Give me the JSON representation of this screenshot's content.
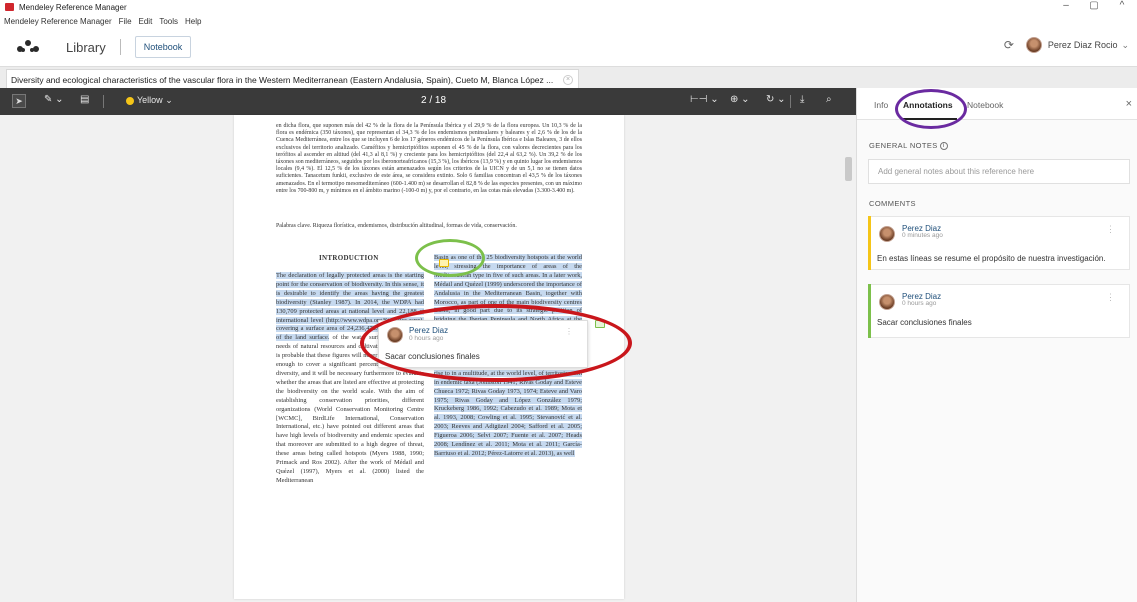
{
  "window": {
    "title": "Mendeley Reference Manager",
    "controls": [
      "–",
      "▢",
      "^"
    ]
  },
  "menu": [
    "Mendeley Reference Manager",
    "File",
    "Edit",
    "Tools",
    "Help"
  ],
  "header": {
    "library_label": "Library",
    "notebook_label": "Notebook",
    "user_name": "Perez Diaz Rocio"
  },
  "doc_tab": {
    "title": "Diversity and ecological characteristics of the vascular flora in the Western Mediterranean (Eastern Andalusia, Spain), Cueto M, Blanca López ..."
  },
  "pdf_toolbar": {
    "color_label": "Yellow",
    "page_indicator": "2 / 18"
  },
  "pdf": {
    "para_top": "en dicha flora, que suponen más del 42 % de la flora de la Península Ibérica y el 29,9 % de la flora europea. Un 10,3 % de la flora es endémica (350 táxones), que representan el 34,3 % de los endemismos peninsulares y baleares y el 2,6 % de los de la Cuenca Mediterránea, entre los que se incluyen 6 de los 17 géneros endémicos de la Península Ibérica e Islas Baleares, 3 de ellos exclusivos del territorio analizado. Caméfitos y hemicriptófitos suponen el 45 % de la flora, con valores decrecientes para los terófitos al ascender en altitud (del 41,3 al 8,1 %) y creciente para los hemicriptófitos (del 22,4 al 63,2 %). Un 39,2 % de los táxones son mediterráneos, seguidos por los iberonorteafricanos (15,3 %), los ibéricos (13,9 %) y en quinto lugar los endemismos locales (9,4 %). El 12,5 % de los táxones están amenazados según los criterios de la UICN y de un 5,1 no se tienen datos suficientes. Tanacetum funkii, exclusivo de este área, se considera extinto. Solo 6 familias concentran el 43,5 % de los táxones amenazados. En el termotipo mesomediterráneo (600-1.400 m) se desarrollan el 82,8 % de las especies presentes, con un máximo entre los 700-800 m, y mínimos en el ámbito marino (-100-0 m) y, por el contrario, en las cotas más elevadas (3.300-3.400 m).",
    "keywords": "Palabras clave. Riqueza florística, endemismos, distribución altitudinal, formas de vida, conservación.",
    "intro_heading": "INTRODUCTION",
    "col_left_hl": "The declaration of legally protected areas is the starting point for the conservation of biodiversity. In this sense, it is desirable to identify the areas having the greatest biodiversity (Stanley 1987). In 2014, the WDPA had 130,709 protected areas at national level and 22,188 at international level (http://www.wdpa.org/Statistics.aspx), covering a surface area of 24,236,478.69 km², a 12.7 % of the land surface.",
    "col_left_rest": "of the water surface). Due to the needs of natural resources and cultivation by humans, it is probable that these figures will never reach values high enough to cover a significant percentage of biological diversity, and it will be necessary furthermore to evaluate whether the areas that are listed are effective at protecting the biodiversity on the world scale. With the aim of establishing conservation priorities, different organizations (World Conservation Monitoring Centre [WCMC], BirdLife International, Conservation International, etc.) have pointed out different areas that have high levels of biodiversity and endemic species and that moreover are submitted to a high degree of threat, these areas being called hotspots (Myers 1988, 1990; Primack and Ros 2002). After the work of Médail and Quézel (1997), Myers et al. (2000) listed the Mediterranean",
    "col_right_hl": "Basin as one of the 25 biodiversity hotspots at the world level, stressing the importance of areas of the Mediterranean type in five of such areas. In a later work, Médail and Quézel (1999) underscored the importance of Andalusia in the Mediterranean Basin, together with Morocco, as part of one of the main biodiversity centres",
    "col_right_rest": "Basin, in good part due to its strategic position of bridging the Iberian Peninsula and North Africa at the end of the Miocene. As well as serving as a refuge for the flora of continental Europe during the period of the glaciations (Blanca 1993) and bearing diverse substrates with nutritional imbalances for plants (volcanic, peridotitic, dolomitic, gypsiferous, saline, etc.), giving rise to in a multitude, at the world level, of territories rich in endemic taxa (Johnston 1941; Rivas Goday and Esteve Chueca 1972; Rivas Goday 1973, 1974; Esteve and Varo 1975; Rivas Goday and López González 1979; Kruckeberg 1986, 1992; Cabezudo et al. 1989; Mota et al. 1993, 2008; Cowling et al. 1995; Stevanović et al. 2003; Reeves and Adigüzel 2004; Safford et al. 2005; Figueroa 2006; Selvi 2007; Fuente et al. 2007; Heads 2008; Lendínez et al. 2011; Mota et al. 2011; García-Barriuso et al. 2012; Pérez-Latorre et al. 2013), as well"
  },
  "popup": {
    "name": "Perez Diaz",
    "time": "0 hours ago",
    "text": "Sacar conclusiones finales"
  },
  "panel": {
    "tabs": [
      "Info",
      "Annotations",
      "Notebook"
    ],
    "close": "×",
    "general_notes_label": "GENERAL NOTES",
    "general_notes_placeholder": "Add general notes about this reference here",
    "comments_label": "COMMENTS",
    "comments": [
      {
        "name": "Perez Diaz",
        "time": "0 minutes ago",
        "text": "En estas líneas se resume el propósito de nuestra investigación.",
        "color": "#f5c518"
      },
      {
        "name": "Perez Diaz",
        "time": "0 hours ago",
        "text": "Sacar conclusiones finales",
        "color": "#7cc04b"
      }
    ]
  },
  "colors": {
    "brand_red": "#d0262d",
    "toolbar_dark": "#3a3a3a",
    "highlight_blue": "#c6d9ef",
    "ring_purple": "#6a2aa0",
    "ring_green": "#7cc04b",
    "ring_red": "#c9161b"
  }
}
